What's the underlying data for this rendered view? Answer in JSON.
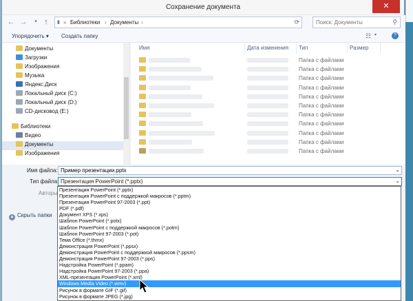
{
  "window": {
    "title": "Сохранение документа",
    "close_glyph": "✕"
  },
  "navbar": {
    "back_icon": "arrow-left-icon",
    "forward_icon": "arrow-right-icon",
    "up_icon": "arrow-up-icon",
    "breadcrumbs": [
      "Библиотеки",
      "Документы"
    ],
    "search_placeholder": "Поиск: Документы"
  },
  "toolbar": {
    "organize_label": "Упорядочить ▾",
    "new_folder_label": "Создать папку"
  },
  "sidebar": {
    "items": [
      {
        "label": "Документы",
        "icon": "documents-icon",
        "color": "#e6c35b"
      },
      {
        "label": "Загрузки",
        "icon": "downloads-icon",
        "color": "#3c8fd8"
      },
      {
        "label": "Изображения",
        "icon": "pictures-icon",
        "color": "#e6c35b"
      },
      {
        "label": "Музыка",
        "icon": "music-icon",
        "color": "#e6c35b"
      },
      {
        "label": "Яндекс.Диск",
        "icon": "yandex-disk-icon",
        "color": "#3a6fb8"
      },
      {
        "label": "Локальный диск (C:)",
        "icon": "drive-icon",
        "color": "#9aa7b4"
      },
      {
        "label": "Локальный диск (D:)",
        "icon": "drive-icon",
        "color": "#9aa7b4"
      },
      {
        "label": "CD-дисковод (E:)",
        "icon": "cd-drive-icon",
        "color": "#9aa7b4"
      },
      {
        "label": "Библиотеки",
        "icon": "libraries-icon",
        "color": "#e6c35b"
      },
      {
        "label": "Видео",
        "icon": "video-icon",
        "color": "#6c7fa0"
      },
      {
        "label": "Документы",
        "icon": "documents-icon",
        "color": "#e6c35b"
      },
      {
        "label": "Изображения",
        "icon": "pictures-icon",
        "color": "#e6c35b"
      }
    ]
  },
  "file_list": {
    "columns": [
      "Имя",
      "Дата изменения",
      "Тип",
      "Размер"
    ],
    "row_type": "Папка с файлами",
    "row_count": 11
  },
  "form": {
    "filename_label": "Имя файла:",
    "filename_value": "Пример презентации.pptx",
    "filetype_label": "Тип файла:",
    "filetype_value": "Презентация PowerPoint (*.pptx)",
    "authors_label": "Авторы:",
    "hide_folders_label": "Скрыть папки"
  },
  "filetype_options": [
    "Презентация PowerPoint (*.pptx)",
    "Презентация PowerPoint с поддержкой макросов (*.pptm)",
    "Презентация PowerPoint 97-2003 (*.ppt)",
    "PDF (*.pdf)",
    "Документ XPS (*.xps)",
    "Шаблон PowerPoint (*.potx)",
    "Шаблон PowerPoint с поддержкой макросов (*.potm)",
    "Шаблон PowerPoint 97-2003 (*.pot)",
    "Тема Office (*.thmx)",
    "Демонстрация PowerPoint (*.ppsx)",
    "Демонстрация PowerPoint с поддержкой макросов (*.ppsm)",
    "Демонстрация PowerPoint 97-2003 (*.pps)",
    "Надстройка PowerPoint (*.ppam)",
    "Надстройка PowerPoint 97-2003 (*.ppa)",
    "XML-презентация PowerPoint (*.xml)",
    "Windows Media Video (*.wmv)",
    "Рисунок в формате GIF (*.gif)",
    "Рисунок в формате JPEG (*.jpg)"
  ],
  "selected_option_index": 15,
  "colors": {
    "selection": "#3399ff",
    "close_button": "#c7312b",
    "folder": "#e8c25f"
  }
}
